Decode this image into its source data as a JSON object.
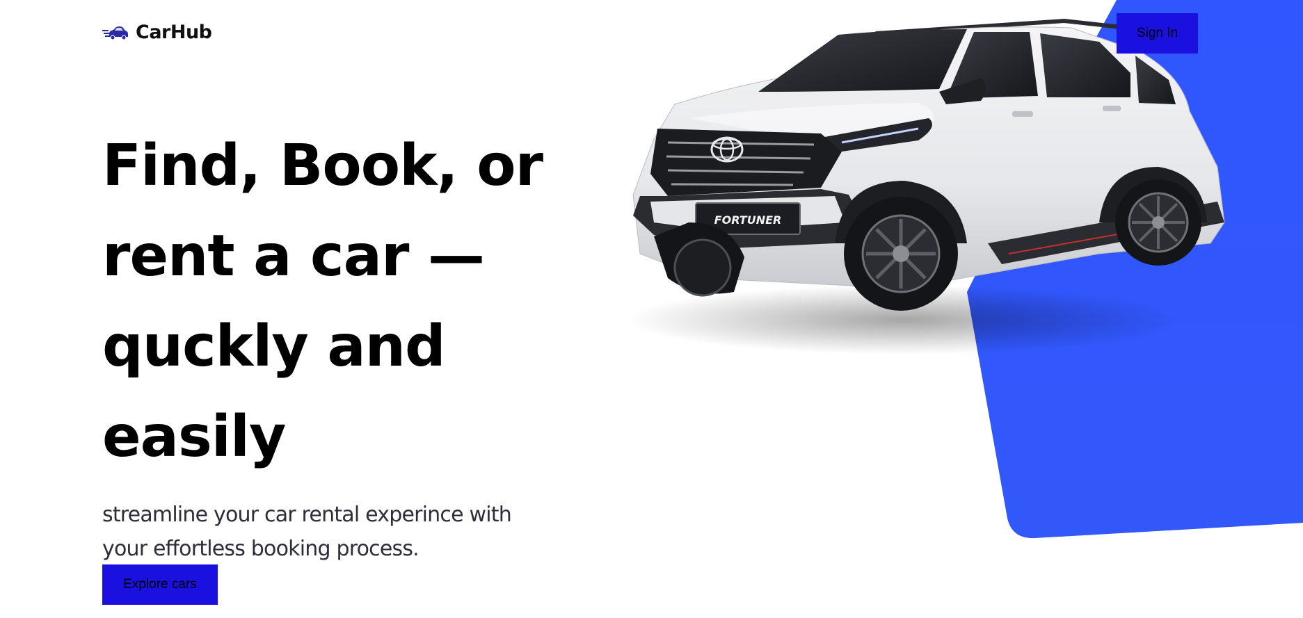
{
  "navbar": {
    "logo_icon": "speeding-car-icon",
    "brand": "CarHub",
    "signin_label": "Sign In"
  },
  "hero": {
    "title": "Find, Book, or rent a car — quckly and easily",
    "subtitle": "streamline your car rental experince with your effortless booking process.",
    "cta_label": "Explore cars",
    "image": "white-toyota-fortuner-suv",
    "plate_text": "FORTUNER"
  },
  "colors": {
    "button_bg": "#1a11e0",
    "blue_shape": "#3059ff",
    "text": "#000000"
  }
}
